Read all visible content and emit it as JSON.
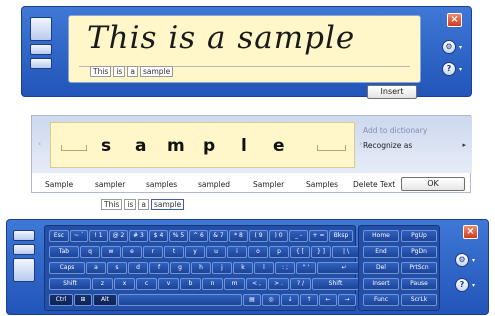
{
  "writing_pad": {
    "ink_text": "This is a sample",
    "recognized_words": [
      "This",
      "is",
      "a",
      "sample"
    ],
    "insert_label": "Insert"
  },
  "correction_panel": {
    "letters": [
      "s",
      "a",
      "m",
      "p",
      "l",
      "e"
    ],
    "menu": {
      "add_to_dictionary": "Add to dictionary",
      "recognize_as": "Recognize as",
      "arrow": "▸"
    },
    "suggestions": [
      "Sample",
      "sampler",
      "samples",
      "sampled",
      "Sampler",
      "Samples"
    ],
    "delete_text": "Delete Text",
    "ok_label": "OK",
    "word_chips": [
      "This",
      "is",
      "a",
      "sample"
    ]
  },
  "keyboard": {
    "rows": [
      [
        "Esc",
        "~ `",
        "! 1",
        "@ 2",
        "# 3",
        "$ 4",
        "% 5",
        "^ 6",
        "& 7",
        "* 8",
        "( 9",
        ") 0",
        "_ -",
        "+ =",
        "Bksp"
      ],
      [
        "Tab",
        "q",
        "w",
        "e",
        "r",
        "t",
        "y",
        "u",
        "i",
        "o",
        "p",
        "{ [",
        "} ]",
        "| \\"
      ],
      [
        "Caps",
        "a",
        "s",
        "d",
        "f",
        "g",
        "h",
        "j",
        "k",
        "l",
        ": ;",
        "\" '",
        "↵"
      ],
      [
        "Shift",
        "z",
        "x",
        "c",
        "v",
        "b",
        "n",
        "m",
        "< ,",
        "> .",
        "? /",
        "Shift"
      ],
      [
        "Ctrl",
        "⊞",
        "Alt",
        "",
        "▤",
        "◎",
        "↓",
        "↑",
        "←",
        "→"
      ]
    ],
    "nav_keys": [
      [
        "Home",
        "PgUp"
      ],
      [
        "End",
        "PgDn"
      ],
      [
        "Del",
        "PrtScn"
      ],
      [
        "Insert",
        "Pause"
      ],
      [
        "Func",
        "ScrLk"
      ]
    ]
  },
  "icons": {
    "close": "close-icon",
    "options": "gear-icon",
    "help": "help-icon"
  }
}
